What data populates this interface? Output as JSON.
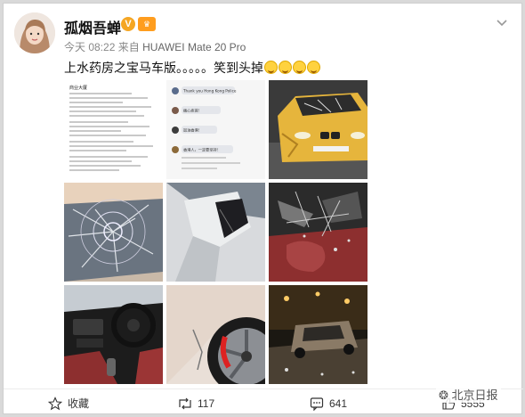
{
  "user": {
    "name": "孤烟吾蝉",
    "verified_badge": "V"
  },
  "post": {
    "meta_time": "今天 08:22",
    "meta_source": "来自",
    "meta_device": "HUAWEI Mate 20 Pro",
    "text": "上水药房之宝马车版。。。。。笑到头掉"
  },
  "screenshot_tile": {
    "heading": "商业大厦",
    "comments": [
      "Thank you Hong Kong Police",
      "痛心疾首！",
      "加油香港！",
      "香港人，一定要坚持！"
    ]
  },
  "actions": {
    "favorite_label": "收藏",
    "repost_count": "117",
    "comment_count": "641",
    "like_count": "5555"
  },
  "watermark": {
    "text": "北京日报"
  },
  "colors": {
    "accent": "#f5a623",
    "text": "#111111",
    "meta": "#888888",
    "car_yellow": "#e6b53c",
    "interior_red": "#8d2f2f"
  }
}
